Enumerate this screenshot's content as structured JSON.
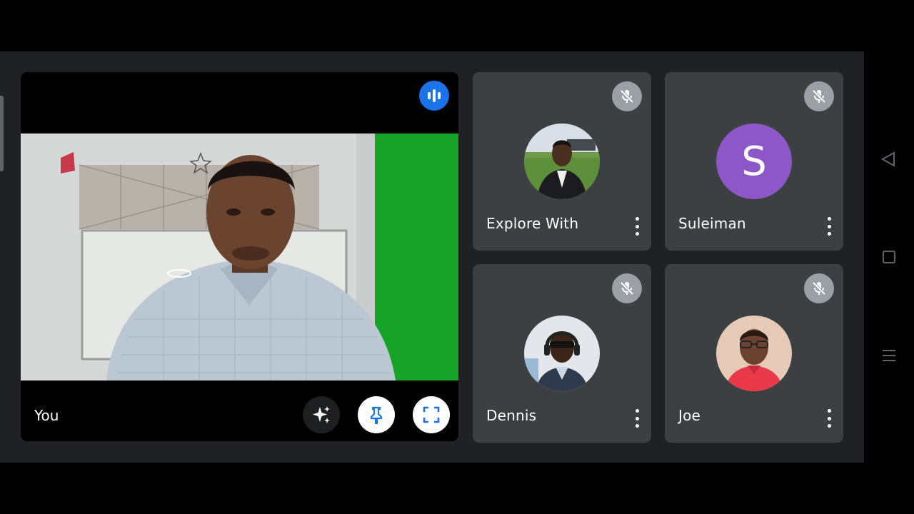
{
  "self": {
    "name": "You",
    "speaking_icon": "audio-bars-icon",
    "controls": [
      {
        "id": "effects",
        "icon": "sparkle-icon"
      },
      {
        "id": "pin",
        "icon": "pin-icon"
      },
      {
        "id": "fullscreen",
        "icon": "fullscreen-icon"
      }
    ]
  },
  "participants": [
    {
      "name": "Explore With",
      "muted": true,
      "avatar": "photo"
    },
    {
      "name": "Suleiman",
      "muted": true,
      "avatar_letter": "S",
      "avatar_color": "#8e57c8"
    },
    {
      "name": "Dennis",
      "muted": true,
      "avatar": "photo"
    },
    {
      "name": "Joe",
      "muted": true,
      "avatar": "photo"
    }
  ],
  "colors": {
    "background": "#202124",
    "tile": "#3c4043",
    "accent_blue": "#1a73e8",
    "mute_badge": "#9aa0a6"
  },
  "system_nav": [
    "back-icon",
    "home-icon",
    "menu-icon"
  ]
}
